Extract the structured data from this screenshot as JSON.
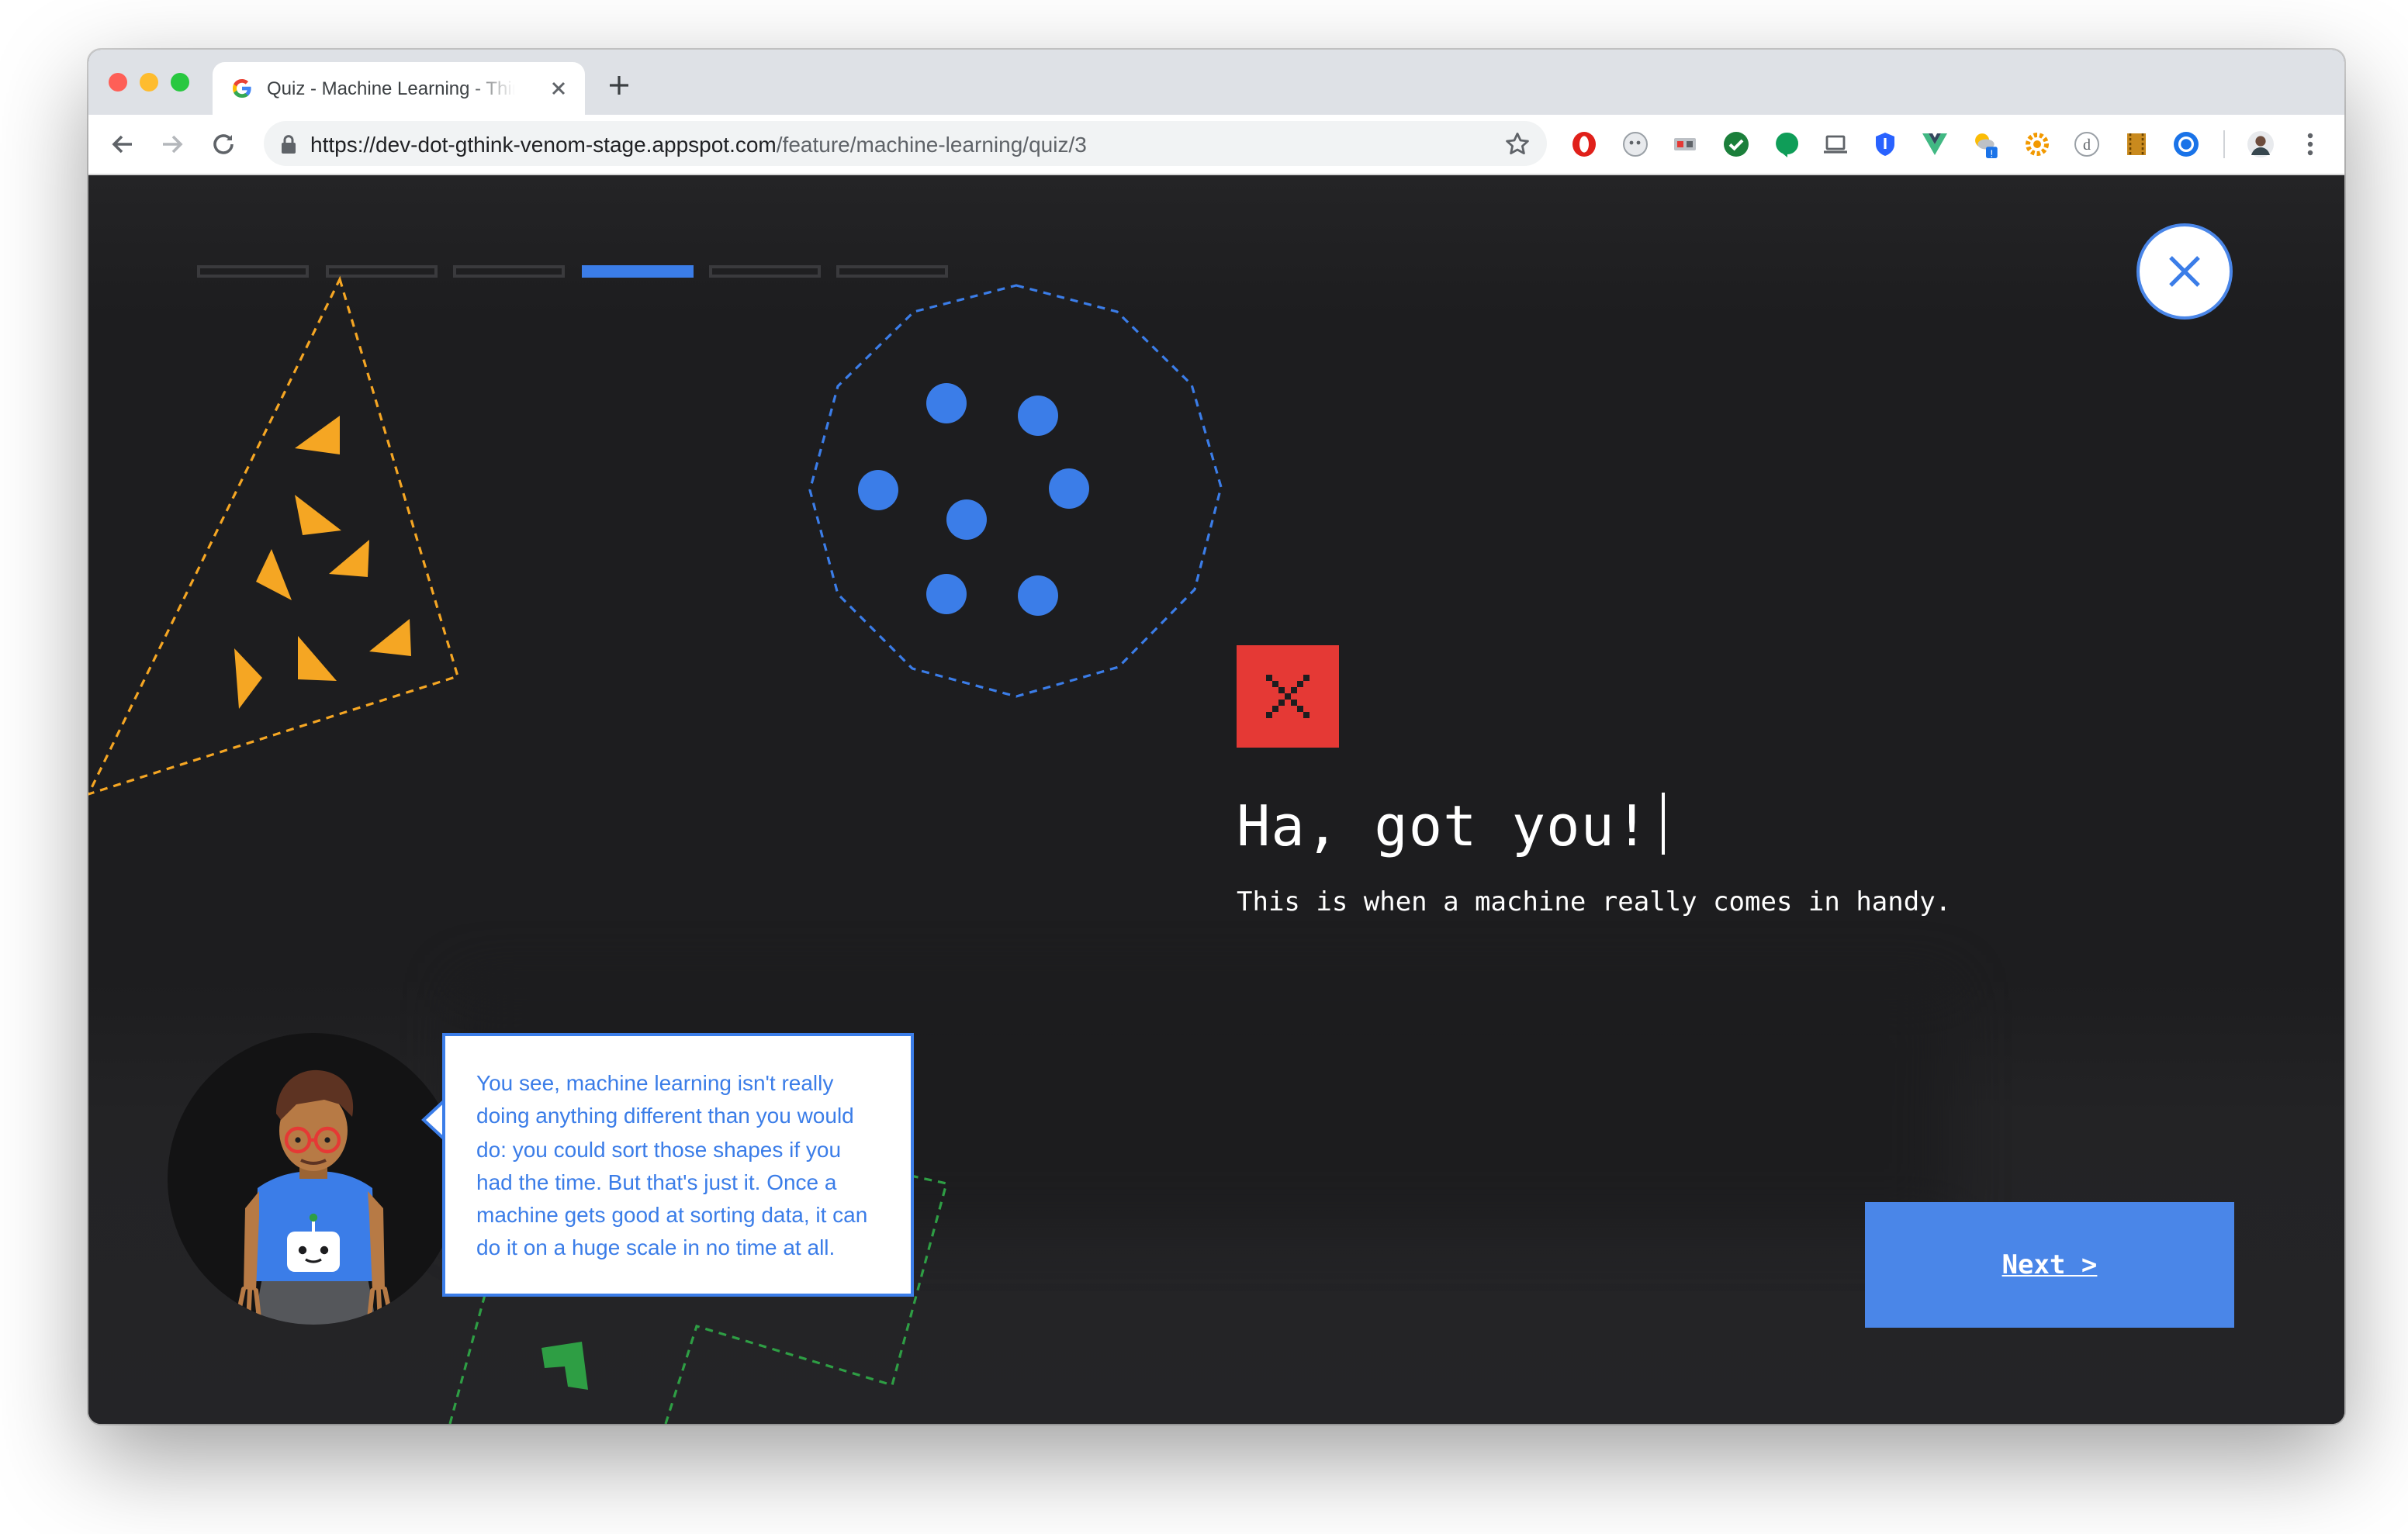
{
  "browser": {
    "tab": {
      "title": "Quiz - Machine Learning - Think with Google"
    },
    "url": {
      "host": "https://dev-dot-gthink-venom-stage.appspot.com",
      "path": "/feature/machine-learning/quiz/3"
    },
    "colors": {
      "tab_strip": "#dee1e6",
      "toolbar": "#ffffff",
      "omnibox": "#f1f3f4"
    },
    "toolbar_icons": [
      "back-arrow-icon",
      "forward-arrow-icon",
      "reload-icon",
      "lock-icon",
      "bookmark-star-icon",
      "menu-kebab-icon"
    ],
    "extension_icons": [
      "opera-icon",
      "ghost-icon",
      "media-icon",
      "check-icon",
      "chat-bubble-icon",
      "laptop-icon",
      "shield-icon",
      "vue-icon",
      "weather-icon",
      "gear-icon",
      "d-icon",
      "film-icon",
      "sync-icon",
      "profile-avatar-icon"
    ]
  },
  "quiz": {
    "progress": {
      "total_steps": 6,
      "current_step": 4
    },
    "result_icon": "x-mark-icon",
    "headline": "Ha, got you!",
    "subheadline": "This is when a machine really comes in handy.",
    "next_label": "Next >",
    "speech": "You see, machine learning isn't really doing anything different than you would do: you could sort those shapes if you had the time. But that's just it. Once a machine gets good at sorting data, it can do it on a huge scale in no time at all."
  },
  "colors": {
    "background": "#1d1d1f",
    "accent_blue": "#3b7de8",
    "button_blue": "#4a86e8",
    "error_red": "#e53935",
    "triangle_yellow": "#f5a623",
    "decor_green": "#2e9e44"
  }
}
